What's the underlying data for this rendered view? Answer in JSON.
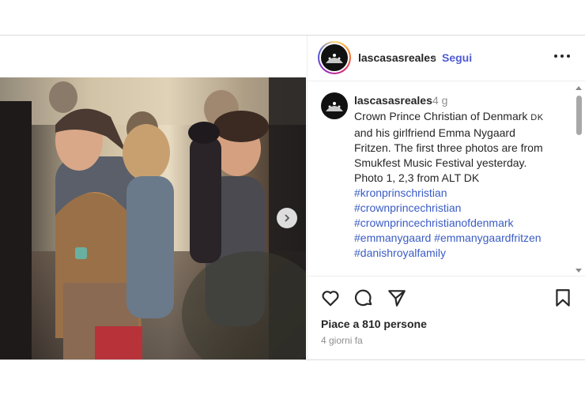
{
  "post": {
    "username": "lascasasreales",
    "separator": "•",
    "follow_label": "Segui",
    "caption": {
      "username": "lascasasreales",
      "time_ago": "4 g",
      "lines": [
        "Crown Prince Christian of Denmark",
        "and his girlfriend Emma Nygaard",
        "Fritzen. The first three photos are from",
        "Smukfest Music Festival yesterday.",
        "Photo 1, 2,3 from ALT DK"
      ],
      "flag_code": "DK",
      "hashtags": [
        "#kronprinschristian",
        "#crownprincechristian",
        "#crownprincechristianofdenmark",
        "#emmanygaard #emmanygaardfritzen",
        "#danishroyalfamily"
      ]
    },
    "likes_text": "Piace a 810 persone",
    "date_text": "4 giorni fa"
  },
  "icons": {
    "more": "more-options-icon",
    "next": "chevron-right-icon",
    "like": "heart-icon",
    "comment": "comment-icon",
    "share": "send-icon",
    "save": "bookmark-icon"
  },
  "colors": {
    "link": "#3b5cc4",
    "follow": "#4f5bd5",
    "muted": "#8e8e8e"
  }
}
